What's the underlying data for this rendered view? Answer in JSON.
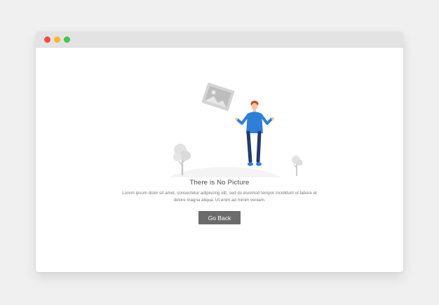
{
  "window": {
    "controls": [
      "close",
      "minimize",
      "maximize"
    ]
  },
  "empty_state": {
    "title": "There is No Picture",
    "description": "Lorem ipsum dolor sit amet, consectetur adipiscing elit, sed do eiusmod tempor incididunt ut labore et dolore magna aliqua. Ut enim ad minim veniam.",
    "button_label": "Go Back"
  },
  "illustration": {
    "icon": "image-placeholder-icon",
    "person": "person-shrugging"
  },
  "colors": {
    "page_bg": "#f0f0f0",
    "titlebar": "#e3e3e3",
    "close": "#ee4a4a",
    "minimize": "#f5b82e",
    "maximize": "#3cc84a",
    "shirt": "#2f7fd6",
    "button": "#6b6b6b"
  }
}
